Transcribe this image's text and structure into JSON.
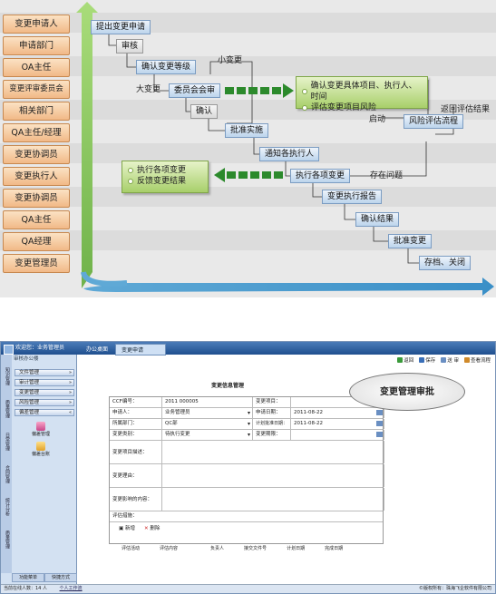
{
  "roles": [
    "变更申请人",
    "申请部门",
    "OA主任",
    "变更评审委员会",
    "相关部门",
    "QA主任/经理",
    "变更协调员",
    "变更执行人",
    "变更协调员",
    "QA主任",
    "QA经理",
    "变更管理员"
  ],
  "steps": {
    "s1": "提出变更申请",
    "s2": "审核",
    "s3": "确认变更等级",
    "s4": "委员会会审",
    "s5": "确认",
    "s6": "批准实施",
    "s7": "通知各执行人",
    "s8": "执行各项变更",
    "s9": "变更执行报告",
    "s10": "确认结果",
    "s11": "批准变更",
    "s12": "存档、关闭",
    "s13": "风险评估流程"
  },
  "boxes": {
    "right": [
      "确认变更具体项目、执行人、时间",
      "评估变更项目风险"
    ],
    "left": [
      "执行各项变更",
      "反馈变更结果"
    ]
  },
  "labels": {
    "small": "小变更",
    "big": "大变更",
    "start": "启动",
    "ret": "返回评估结果",
    "issue": "存在问题"
  },
  "app": {
    "user_line1": "欢迎您：业务管理员",
    "user_line2": "审核办公楼",
    "tabs": [
      "办公桌面",
      "变更申请"
    ],
    "toolbar": [
      "返回",
      "保存",
      "送 审",
      "查看流程"
    ],
    "menu": [
      "文件管理",
      "审计管理",
      "变更管理",
      "风险管理",
      "偏差管理"
    ],
    "vtabs": [
      "知识管理",
      "质量管理",
      "日常管理",
      "合同管理",
      "统计分析",
      "质量管理"
    ],
    "menu_icons": [
      "偏差管理",
      "偏差台账"
    ],
    "bottom_tabs": [
      "功能菜单",
      "快捷方式"
    ],
    "status_left": "当前在线人数：14 人",
    "status_link": "个人工作流",
    "status_right": "©版权所有：珠海飞企软件有限公司",
    "form_title": "变更信息管理",
    "fields": {
      "ccf_label": "CCF编号：",
      "ccf_value": "2011 000005",
      "proj_label": "变更项目：",
      "applicant_label": "申请人：",
      "applicant_value": "业务管理员",
      "date_label": "申请日期：",
      "date_value": "2011-08-22",
      "dept_label": "所属部门：",
      "dept_value": "QC部",
      "plan_label": "计划批准日期：",
      "plan_value": "2011-08-22",
      "type_label": "变更类别：",
      "type_value": "待执行变更",
      "deadline_label": "变更期限：",
      "desc_label": "变更项目描述：",
      "reason_label": "变更理由：",
      "impact_label": "变更影响的内容：",
      "measure_label": "评估措施：",
      "add": "新增",
      "del": "删除"
    },
    "grid_cols": [
      "评估活动",
      "评估内容",
      "负责人",
      "接交文件号",
      "计划日期",
      "完成日期"
    ],
    "callout": "变更管理审批"
  }
}
